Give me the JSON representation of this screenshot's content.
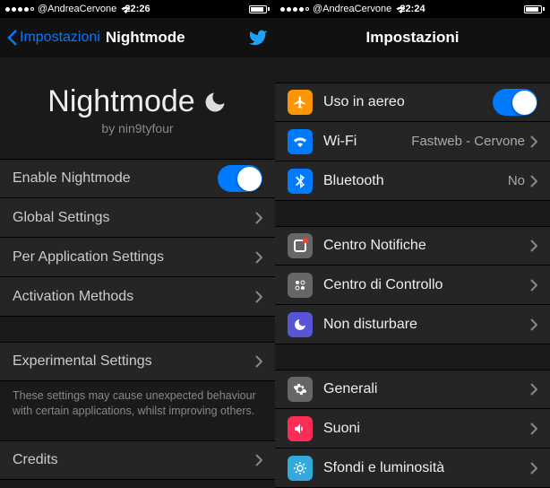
{
  "left": {
    "status": {
      "carrier": "@AndreaCervone",
      "time": "22:26"
    },
    "nav": {
      "back": "Impostazioni",
      "title": "Nightmode"
    },
    "hero": {
      "title": "Nightmode",
      "subtitle": "by nin9tyfour"
    },
    "rows": {
      "enable": "Enable Nightmode",
      "global": "Global Settings",
      "perapp": "Per Application Settings",
      "activation": "Activation Methods",
      "experimental": "Experimental Settings",
      "credits": "Credits"
    },
    "footer": "These settings may cause unexpected behaviour with certain applications, whilst improving others."
  },
  "right": {
    "status": {
      "carrier": "@AndreaCervone",
      "time": "22:24"
    },
    "nav": {
      "title": "Impostazioni"
    },
    "rows": {
      "airplane": {
        "label": "Uso in aereo"
      },
      "wifi": {
        "label": "Wi-Fi",
        "value": "Fastweb - Cervone"
      },
      "bt": {
        "label": "Bluetooth",
        "value": "No"
      },
      "notif": {
        "label": "Centro Notifiche"
      },
      "cc": {
        "label": "Centro di Controllo"
      },
      "dnd": {
        "label": "Non disturbare"
      },
      "general": {
        "label": "Generali"
      },
      "sounds": {
        "label": "Suoni"
      },
      "wallpaper": {
        "label": "Sfondi e luminosità"
      }
    }
  }
}
